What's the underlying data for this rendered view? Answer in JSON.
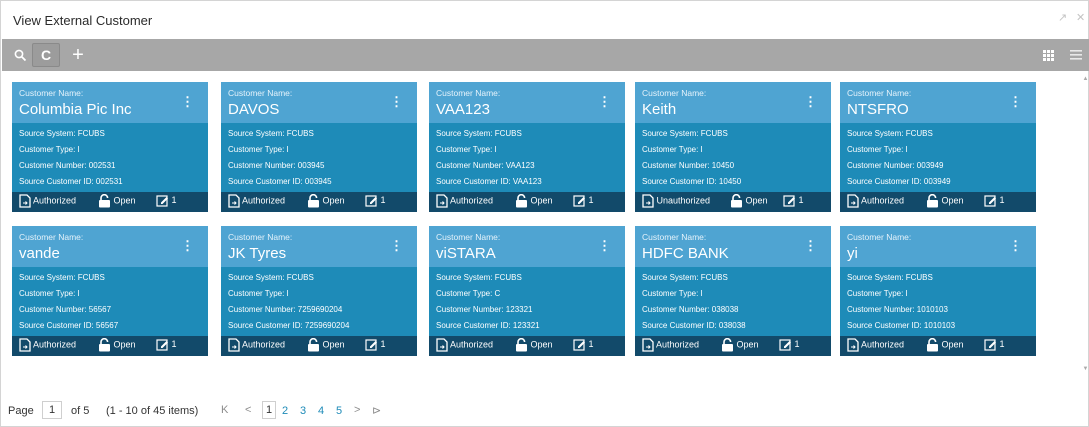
{
  "window": {
    "title": "View External Customer"
  },
  "toolbar": {
    "search_icon": "search-icon",
    "refresh_icon": "refresh-icon",
    "add_icon": "add-icon",
    "grid_icon": "grid-view-icon",
    "list_icon": "list-view-icon"
  },
  "colors": {
    "toolbar_bg": "#a7a7a7",
    "card_head": "#4fa4d2",
    "card_body": "#1e8bb8",
    "card_foot": "#124a6a",
    "link": "#1e8bb8"
  },
  "labels": {
    "customer_name": "Customer Name:",
    "source_system": "Source System:",
    "customer_type": "Customer Type:",
    "customer_number": "Customer Number:",
    "source_customer_id": "Source Customer ID:"
  },
  "cards": [
    {
      "name": "Columbia Pic Inc",
      "source_system": "Source System: FCUBS",
      "customer_type": "Customer Type: I",
      "customer_number": "Customer Number: 002531",
      "source_customer_id": "Source Customer ID: 002531",
      "auth": "Authorized",
      "lock": "Open",
      "edits": "1"
    },
    {
      "name": "DAVOS",
      "source_system": "Source System: FCUBS",
      "customer_type": "Customer Type: I",
      "customer_number": "Customer Number: 003945",
      "source_customer_id": "Source Customer ID: 003945",
      "auth": "Authorized",
      "lock": "Open",
      "edits": "1"
    },
    {
      "name": "VAA123",
      "source_system": "Source System: FCUBS",
      "customer_type": "Customer Type: I",
      "customer_number": "Customer Number: VAA123",
      "source_customer_id": "Source Customer ID: VAA123",
      "auth": "Authorized",
      "lock": "Open",
      "edits": "1"
    },
    {
      "name": "Keith",
      "source_system": "Source System: FCUBS",
      "customer_type": "Customer Type: I",
      "customer_number": "Customer Number: 10450",
      "source_customer_id": "Source Customer ID: 10450",
      "auth": "Unauthorized",
      "lock": "Open",
      "edits": "1"
    },
    {
      "name": "NTSFRO",
      "source_system": "Source System: FCUBS",
      "customer_type": "Customer Type: I",
      "customer_number": "Customer Number: 003949",
      "source_customer_id": "Source Customer ID: 003949",
      "auth": "Authorized",
      "lock": "Open",
      "edits": "1"
    },
    {
      "name": "vande",
      "source_system": "Source System: FCUBS",
      "customer_type": "Customer Type: I",
      "customer_number": "Customer Number: 56567",
      "source_customer_id": "Source Customer ID: 56567",
      "auth": "Authorized",
      "lock": "Open",
      "edits": "1"
    },
    {
      "name": "JK Tyres",
      "source_system": "Source System: FCUBS",
      "customer_type": "Customer Type: I",
      "customer_number": "Customer Number: 7259690204",
      "source_customer_id": "Source Customer ID: 7259690204",
      "auth": "Authorized",
      "lock": "Open",
      "edits": "1"
    },
    {
      "name": "viSTARA",
      "source_system": "Source System: FCUBS",
      "customer_type": "Customer Type: C",
      "customer_number": "Customer Number: 123321",
      "source_customer_id": "Source Customer ID: 123321",
      "auth": "Authorized",
      "lock": "Open",
      "edits": "1"
    },
    {
      "name": "HDFC BANK",
      "source_system": "Source System: FCUBS",
      "customer_type": "Customer Type: I",
      "customer_number": "Customer Number: 038038",
      "source_customer_id": "Source Customer ID: 038038",
      "auth": "Authorized",
      "lock": "Open",
      "edits": "1"
    },
    {
      "name": "yi",
      "source_system": "Source System: FCUBS",
      "customer_type": "Customer Type: I",
      "customer_number": "Customer Number: 1010103",
      "source_customer_id": "Source Customer ID: 1010103",
      "auth": "Authorized",
      "lock": "Open",
      "edits": "1"
    }
  ],
  "pager": {
    "page_label": "Page",
    "current_page": "1",
    "of_text": "of 5",
    "items_text": "(1 - 10 of 45 items)",
    "first": "K",
    "prev": "<",
    "pages": [
      "1",
      "2",
      "3",
      "4",
      "5"
    ],
    "next": ">",
    "last": "⊳"
  }
}
